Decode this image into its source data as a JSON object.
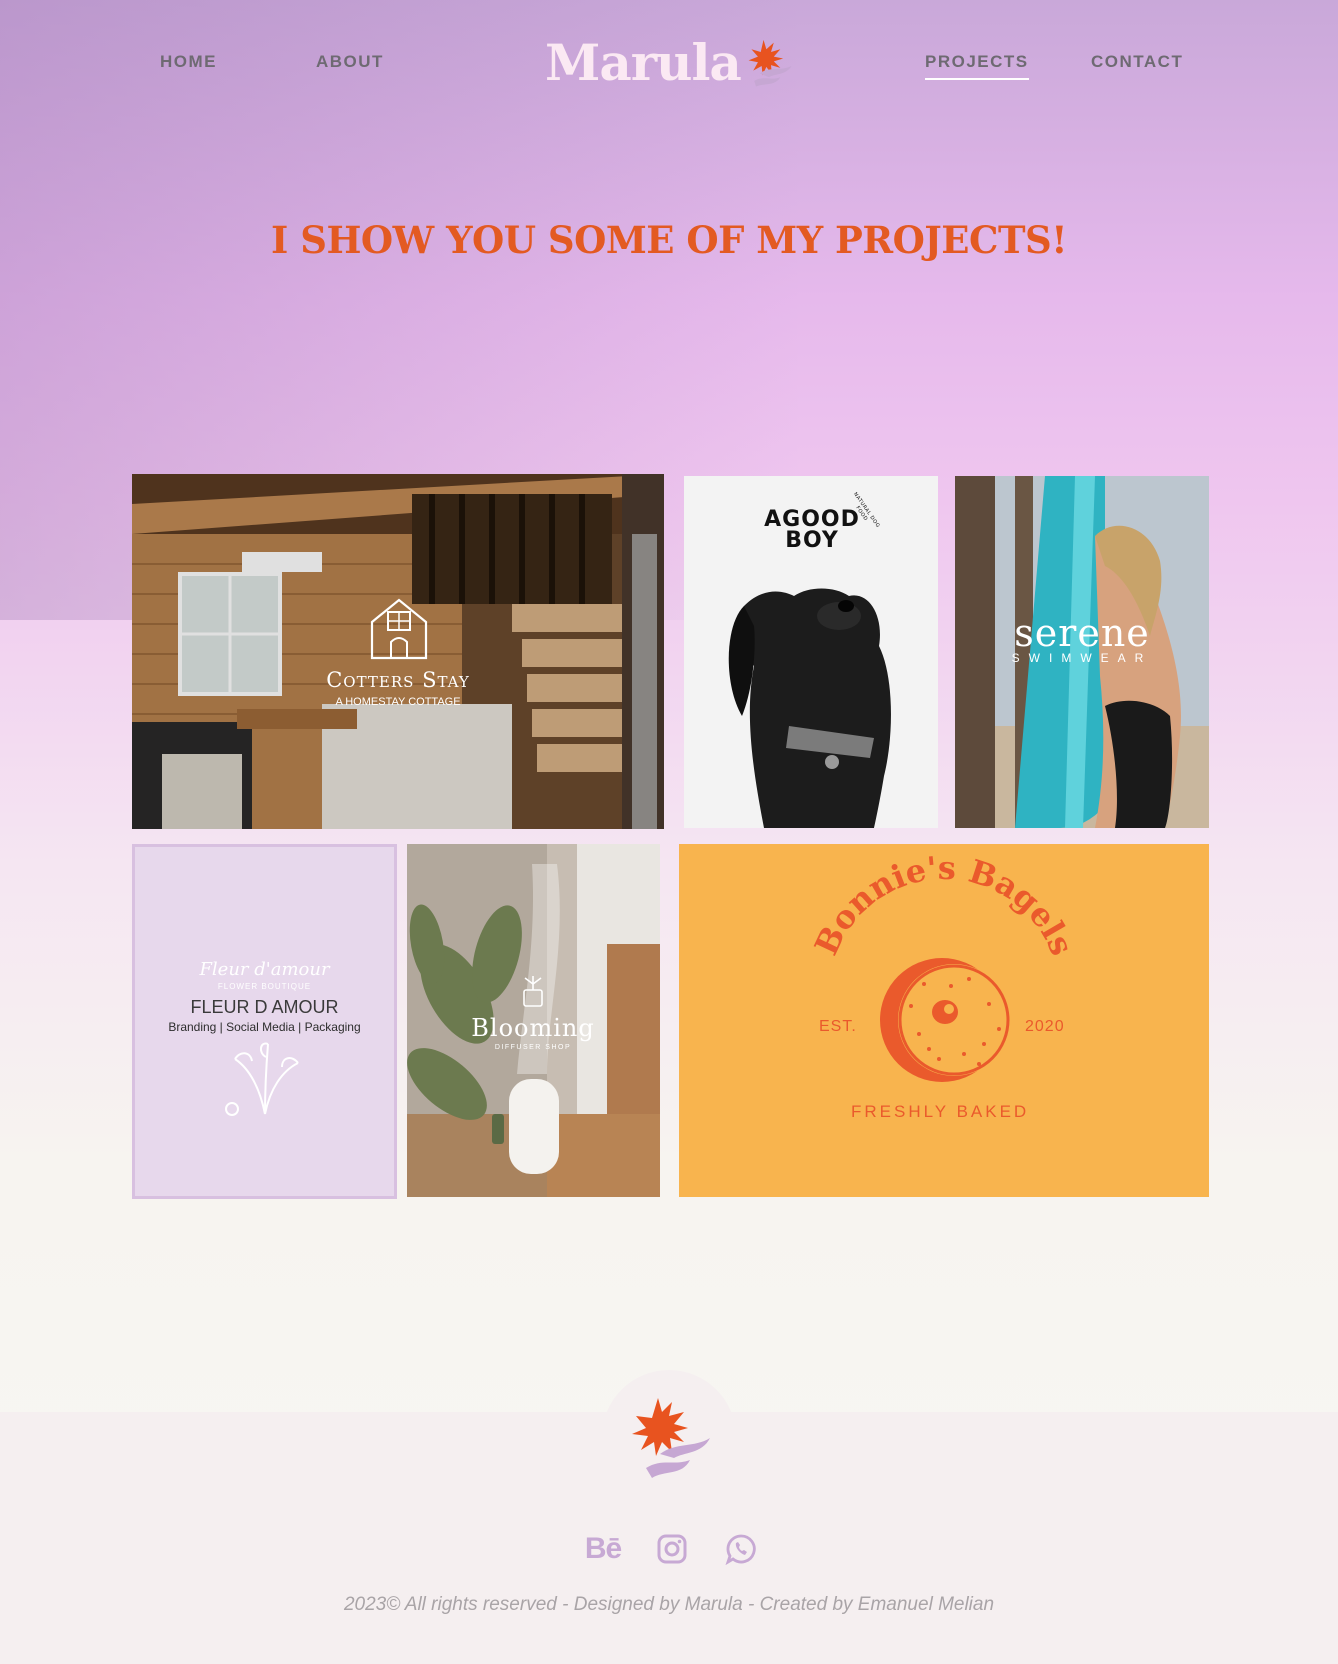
{
  "nav": {
    "home": "HOME",
    "about": "ABOUT",
    "logo_text": "Marula",
    "projects": "PROJECTS",
    "contact": "CONTACT"
  },
  "hero": {
    "title": "I SHOW YOU SOME OF MY PROJECTS!"
  },
  "projects": {
    "cotters": {
      "name": "Cotters Stay",
      "subtitle": "A HOMESTAY COTTAGE"
    },
    "goodboy": {
      "line1": "AGOOD",
      "line2": "BOY",
      "badge": "NATURAL DOG FOOD"
    },
    "serene": {
      "name": "serene",
      "subtitle": "SWIMWEAR"
    },
    "fleur": {
      "script": "Fleur d'amour",
      "tiny": "FLOWER BOUTIQUE",
      "title": "FLEUR D AMOUR",
      "tags": "Branding  |  Social Media |  Packaging"
    },
    "blooming": {
      "name": "Blooming",
      "subtitle": "DIFFUSER SHOP"
    },
    "bonnie": {
      "name": "Bonnie's Bagels",
      "est": "EST.",
      "year": "2020",
      "tagline": "FRESHLY BAKED"
    }
  },
  "footer": {
    "copyright": "2023© All rights reserved - Designed by Marula - Created by Emanuel Melian",
    "behance": "Bē",
    "icons": [
      "behance-icon",
      "instagram-icon",
      "whatsapp-icon"
    ]
  },
  "colors": {
    "accent": "#e35a22",
    "nav_text": "#6e6a72",
    "bonnie_bg": "#f8b44e",
    "fleur_bg": "#e7d8ec",
    "social_icon": "#c7a9d4"
  }
}
